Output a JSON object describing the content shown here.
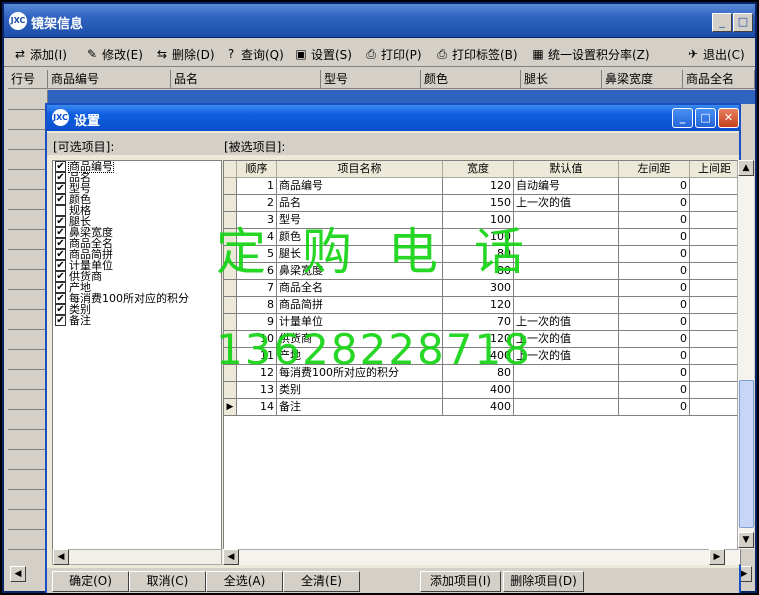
{
  "main_window": {
    "title": "镜架信息",
    "app_icon": "JXC",
    "toolbar": [
      {
        "icon": "add-icon",
        "glyph": "⇄",
        "label": "添加(I)"
      },
      {
        "icon": "edit-icon",
        "glyph": "✎",
        "label": "修改(E)"
      },
      {
        "icon": "delete-icon",
        "glyph": "⇆",
        "label": "删除(D)"
      },
      {
        "icon": "query-icon",
        "glyph": "?",
        "label": "查询(Q)"
      },
      {
        "icon": "settings-icon",
        "glyph": "▣",
        "label": "设置(S)"
      },
      {
        "icon": "print-icon",
        "glyph": "⎙",
        "label": "打印(P)"
      },
      {
        "icon": "print-label-icon",
        "glyph": "⎙",
        "label": "打印标签(B)"
      },
      {
        "icon": "calculator-icon",
        "glyph": "▦",
        "label": "统一设置积分率(Z)"
      },
      {
        "icon": "exit-icon",
        "glyph": "✈",
        "label": "退出(C)"
      }
    ],
    "grid_columns": [
      "行号",
      "商品编号",
      "品名",
      "型号",
      "颜色",
      "腿长",
      "鼻梁宽度",
      "商品全名"
    ]
  },
  "dialog": {
    "title": "设置",
    "app_icon": "JXC",
    "available_label": "[可选项目]:",
    "selected_label": "[被选项目]:",
    "available_items": [
      {
        "label": "商品编号",
        "checked": true
      },
      {
        "label": "品名",
        "checked": true
      },
      {
        "label": "型号",
        "checked": true
      },
      {
        "label": "颜色",
        "checked": true
      },
      {
        "label": "规格",
        "checked": false
      },
      {
        "label": "腿长",
        "checked": true
      },
      {
        "label": "鼻梁宽度",
        "checked": true
      },
      {
        "label": "商品全名",
        "checked": true
      },
      {
        "label": "商品简拼",
        "checked": true
      },
      {
        "label": "计量单位",
        "checked": true
      },
      {
        "label": "供货商",
        "checked": true
      },
      {
        "label": "产地",
        "checked": true
      },
      {
        "label": "每消费100所对应的积分",
        "checked": true
      },
      {
        "label": "类别",
        "checked": true
      },
      {
        "label": "备注",
        "checked": true
      }
    ],
    "selected_columns": [
      "顺序",
      "项目名称",
      "宽度",
      "默认值",
      "左间距",
      "上间距"
    ],
    "selected_rows": [
      {
        "order": "1",
        "name": "商品编号",
        "width": "120",
        "default": "自动编号",
        "left": "0"
      },
      {
        "order": "2",
        "name": "品名",
        "width": "150",
        "default": "上一次的值",
        "left": "0"
      },
      {
        "order": "3",
        "name": "型号",
        "width": "100",
        "default": "",
        "left": "0"
      },
      {
        "order": "4",
        "name": "颜色",
        "width": "100",
        "default": "",
        "left": "0"
      },
      {
        "order": "5",
        "name": "腿长",
        "width": "80",
        "default": "",
        "left": "0"
      },
      {
        "order": "6",
        "name": "鼻梁宽度",
        "width": "80",
        "default": "",
        "left": "0"
      },
      {
        "order": "7",
        "name": "商品全名",
        "width": "300",
        "default": "",
        "left": "0"
      },
      {
        "order": "8",
        "name": "商品简拼",
        "width": "120",
        "default": "",
        "left": "0"
      },
      {
        "order": "9",
        "name": "计量单位",
        "width": "70",
        "default": "上一次的值",
        "left": "0"
      },
      {
        "order": "10",
        "name": "供货商",
        "width": "120",
        "default": "上一次的值",
        "left": "0"
      },
      {
        "order": "11",
        "name": "产地",
        "width": "400",
        "default": "上一次的值",
        "left": "0"
      },
      {
        "order": "12",
        "name": "每消费100所对应的积分",
        "width": "80",
        "default": "",
        "left": "0"
      },
      {
        "order": "13",
        "name": "类别",
        "width": "400",
        "default": "",
        "left": "0"
      },
      {
        "order": "14",
        "name": "备注",
        "width": "400",
        "default": "",
        "left": "0"
      }
    ],
    "current_row_marker": "▶",
    "buttons": {
      "ok": "确定(O)",
      "cancel": "取消(C)",
      "select_all": "全选(A)",
      "clear_all": "全清(E)",
      "add_item": "添加项目(I)",
      "remove_item": "删除项目(D)"
    }
  },
  "watermark": {
    "line1": "定购电话",
    "line2": "13628228718"
  },
  "colors": {
    "main_title_bar": "#2f63c0",
    "dialog_title_bar": "#0f5fe0",
    "watermark": "#14d414",
    "selection": "#2f63c0"
  }
}
